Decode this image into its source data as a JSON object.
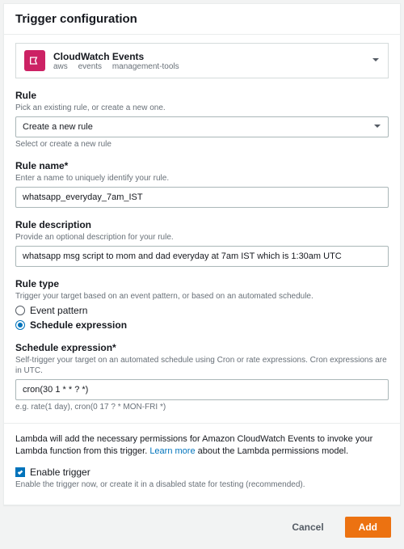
{
  "header": {
    "title": "Trigger configuration"
  },
  "service": {
    "name": "CloudWatch Events",
    "crumb1": "aws",
    "crumb2": "events",
    "crumb3": "management-tools"
  },
  "rule": {
    "label": "Rule",
    "help": "Pick an existing rule, or create a new one.",
    "value": "Create a new rule",
    "sub_help": "Select or create a new rule"
  },
  "name": {
    "label": "Rule name*",
    "help": "Enter a name to uniquely identify your rule.",
    "value": "whatsapp_everyday_7am_IST"
  },
  "desc": {
    "label": "Rule description",
    "help": "Provide an optional description for your rule.",
    "value": "whatsapp msg script to mom and dad everyday at 7am IST which is 1:30am UTC"
  },
  "type": {
    "label": "Rule type",
    "help": "Trigger your target based on an event pattern, or based on an automated schedule.",
    "option1": "Event pattern",
    "option2": "Schedule expression"
  },
  "schedule": {
    "label": "Schedule expression*",
    "help": "Self-trigger your target on an automated schedule using Cron or rate expressions. Cron expressions are in UTC.",
    "value": "cron(30 1 * * ? *)",
    "example": "e.g. rate(1 day), cron(0 17 ? * MON-FRI *)"
  },
  "permissions": {
    "text_a": "Lambda will add the necessary permissions for Amazon CloudWatch Events to invoke your Lambda function from this trigger. ",
    "link": "Learn more",
    "text_b": " about the Lambda permissions model."
  },
  "enable": {
    "label": "Enable trigger",
    "help": "Enable the trigger now, or create it in a disabled state for testing (recommended)."
  },
  "footer": {
    "cancel": "Cancel",
    "add": "Add"
  }
}
